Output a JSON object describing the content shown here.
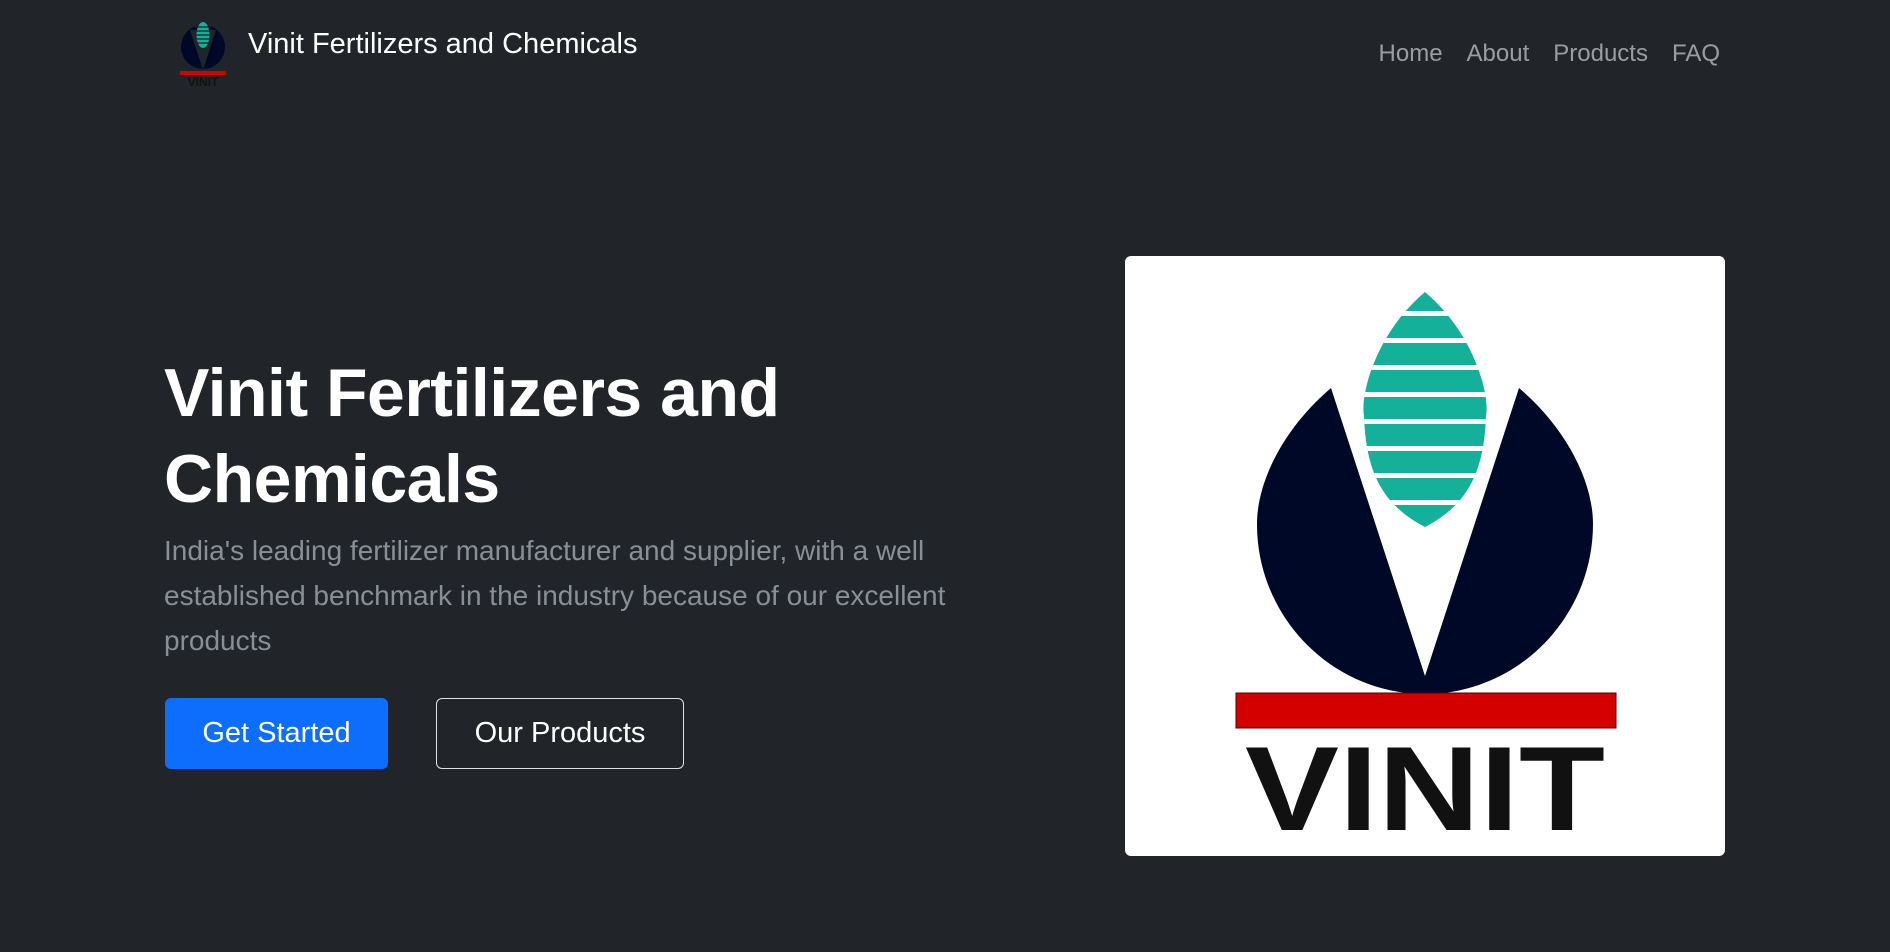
{
  "navbar": {
    "brand_name": "Vinit Fertilizers and Chemicals",
    "logo_text": "VINIT",
    "links": [
      "Home",
      "About",
      "Products",
      "FAQ"
    ]
  },
  "hero": {
    "title": "Vinit Fertilizers and Chemicals",
    "lead": "India's leading fertilizer manufacturer and supplier, with a well established benchmark in the industry because of our excellent products",
    "primary_button": "Get Started",
    "secondary_button": "Our Products",
    "logo_text": "VINIT"
  },
  "colors": {
    "background": "#212529",
    "primary": "#0d6efd",
    "logo_navy": "#000828",
    "logo_teal": "#14b09a",
    "logo_red": "#d40000"
  }
}
